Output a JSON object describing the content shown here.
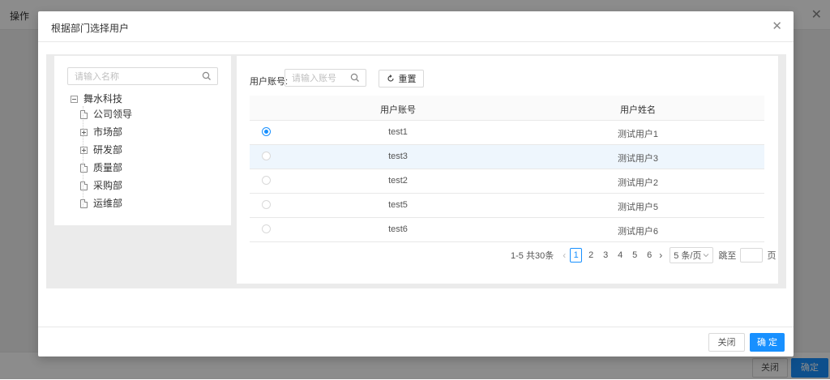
{
  "background": {
    "header_title": "操作",
    "footer_close": "关闭",
    "footer_ok": "确定"
  },
  "modal": {
    "title": "根据部门选择用户",
    "close_label": "关闭",
    "ok_label": "确 定"
  },
  "tree": {
    "search_placeholder": "请输入名称",
    "root": "舞水科技",
    "nodes": [
      {
        "label": "公司领导",
        "type": "leaf"
      },
      {
        "label": "市场部",
        "type": "collapsed"
      },
      {
        "label": "研发部",
        "type": "collapsed"
      },
      {
        "label": "质量部",
        "type": "leaf"
      },
      {
        "label": "采购部",
        "type": "leaf"
      },
      {
        "label": "运维部",
        "type": "leaf"
      }
    ]
  },
  "filter": {
    "account_label": "用户账号:",
    "account_placeholder": "请输入账号",
    "reset_label": "重置"
  },
  "table": {
    "headers": [
      "用户账号",
      "用户姓名"
    ],
    "rows": [
      {
        "account": "test1",
        "name": "测试用户1",
        "selected": true
      },
      {
        "account": "test3",
        "name": "测试用户3",
        "selected": false
      },
      {
        "account": "test2",
        "name": "测试用户2",
        "selected": false
      },
      {
        "account": "test5",
        "name": "测试用户5",
        "selected": false
      },
      {
        "account": "test6",
        "name": "测试用户6",
        "selected": false
      }
    ]
  },
  "pagination": {
    "total_text": "1-5 共30条",
    "pages": [
      "1",
      "2",
      "3",
      "4",
      "5",
      "6"
    ],
    "current_page": "1",
    "page_size": "5 条/页",
    "jump_label": "跳至",
    "jump_suffix": "页"
  },
  "colors": {
    "primary": "#1890ff",
    "highlight_row": "#eef6fd"
  }
}
